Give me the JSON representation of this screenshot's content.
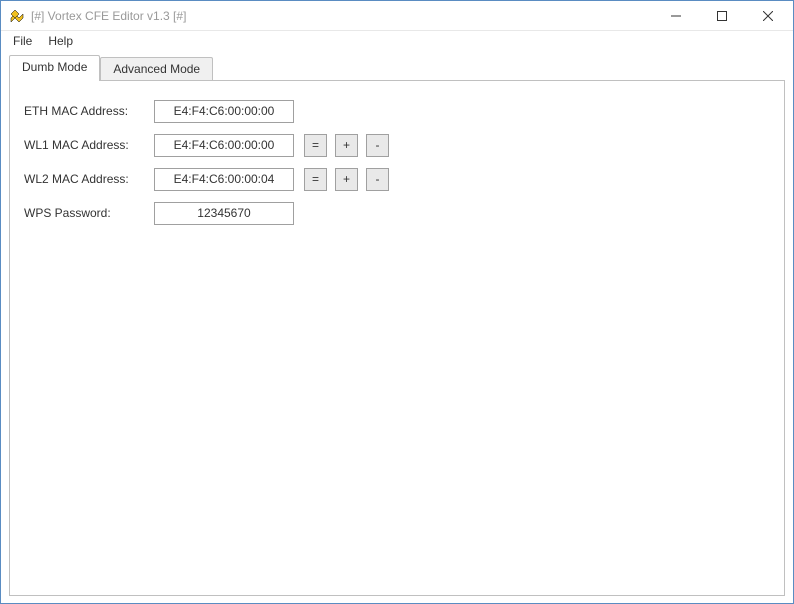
{
  "window": {
    "title": "[#] Vortex CFE Editor v1.3 [#]"
  },
  "menu": {
    "file": "File",
    "help": "Help"
  },
  "tabs": {
    "dumb": "Dumb Mode",
    "advanced": "Advanced Mode"
  },
  "form": {
    "eth_mac": {
      "label": "ETH MAC Address:",
      "value": "E4:F4:C6:00:00:00"
    },
    "wl1_mac": {
      "label": "WL1 MAC Address:",
      "value": "E4:F4:C6:00:00:00"
    },
    "wl2_mac": {
      "label": "WL2 MAC Address:",
      "value": "E4:F4:C6:00:00:04"
    },
    "wps": {
      "label": "WPS Password:",
      "value": "12345670"
    }
  },
  "buttons": {
    "eq": "=",
    "plus": "+",
    "minus": "-"
  }
}
